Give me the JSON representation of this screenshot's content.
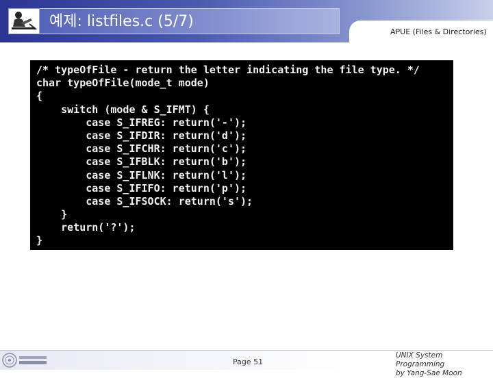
{
  "header": {
    "title": "예제: listfiles.c (5/7)",
    "subtitle": "APUE (Files & Directories)"
  },
  "code": {
    "lines": [
      "/* typeOfFile - return the letter indicating the file type. */",
      "char typeOfFile(mode_t mode)",
      "{",
      "    switch (mode & S_IFMT) {",
      "        case S_IFREG: return('-');",
      "        case S_IFDIR: return('d');",
      "        case S_IFCHR: return('c');",
      "        case S_IFBLK: return('b');",
      "        case S_IFLNK: return('l');",
      "        case S_IFIFO: return('p');",
      "        case S_IFSOCK: return('s');",
      "    }",
      "    return('?');",
      "}"
    ]
  },
  "footer": {
    "page": "Page 51",
    "credit_line1": "UNIX System Programming",
    "credit_line2": "by Yang-Sae Moon"
  },
  "colors": {
    "header_blue": "#2a3590",
    "code_background": "#000000",
    "code_text": "#f2f2f2"
  }
}
